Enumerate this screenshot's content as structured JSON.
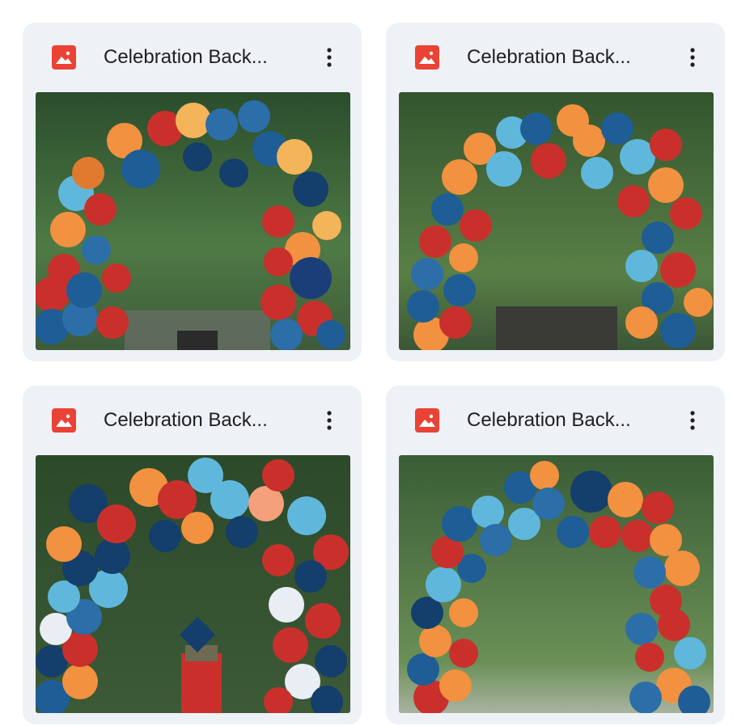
{
  "files": [
    {
      "title": "Celebration Back...",
      "type_icon": "image-file-icon",
      "menu_icon": "more-vert-icon",
      "preview": "balloon-arch-1"
    },
    {
      "title": "Celebration Back...",
      "type_icon": "image-file-icon",
      "menu_icon": "more-vert-icon",
      "preview": "balloon-arch-2"
    },
    {
      "title": "Celebration Back...",
      "type_icon": "image-file-icon",
      "menu_icon": "more-vert-icon",
      "preview": "balloon-arch-3"
    },
    {
      "title": "Celebration Back...",
      "type_icon": "image-file-icon",
      "menu_icon": "more-vert-icon",
      "preview": "balloon-arch-4"
    }
  ],
  "colors": {
    "card_bg": "#eef1f6",
    "icon_red": "#ea4335",
    "title": "#1f1f1f",
    "balloon_navy": "#143e6b",
    "balloon_blue": "#2b6ea8",
    "balloon_sky": "#5fb8dc",
    "balloon_orange": "#f2913f",
    "balloon_red": "#c9302c",
    "balloon_white": "#e8eef3",
    "foliage": "#2f5a32"
  }
}
